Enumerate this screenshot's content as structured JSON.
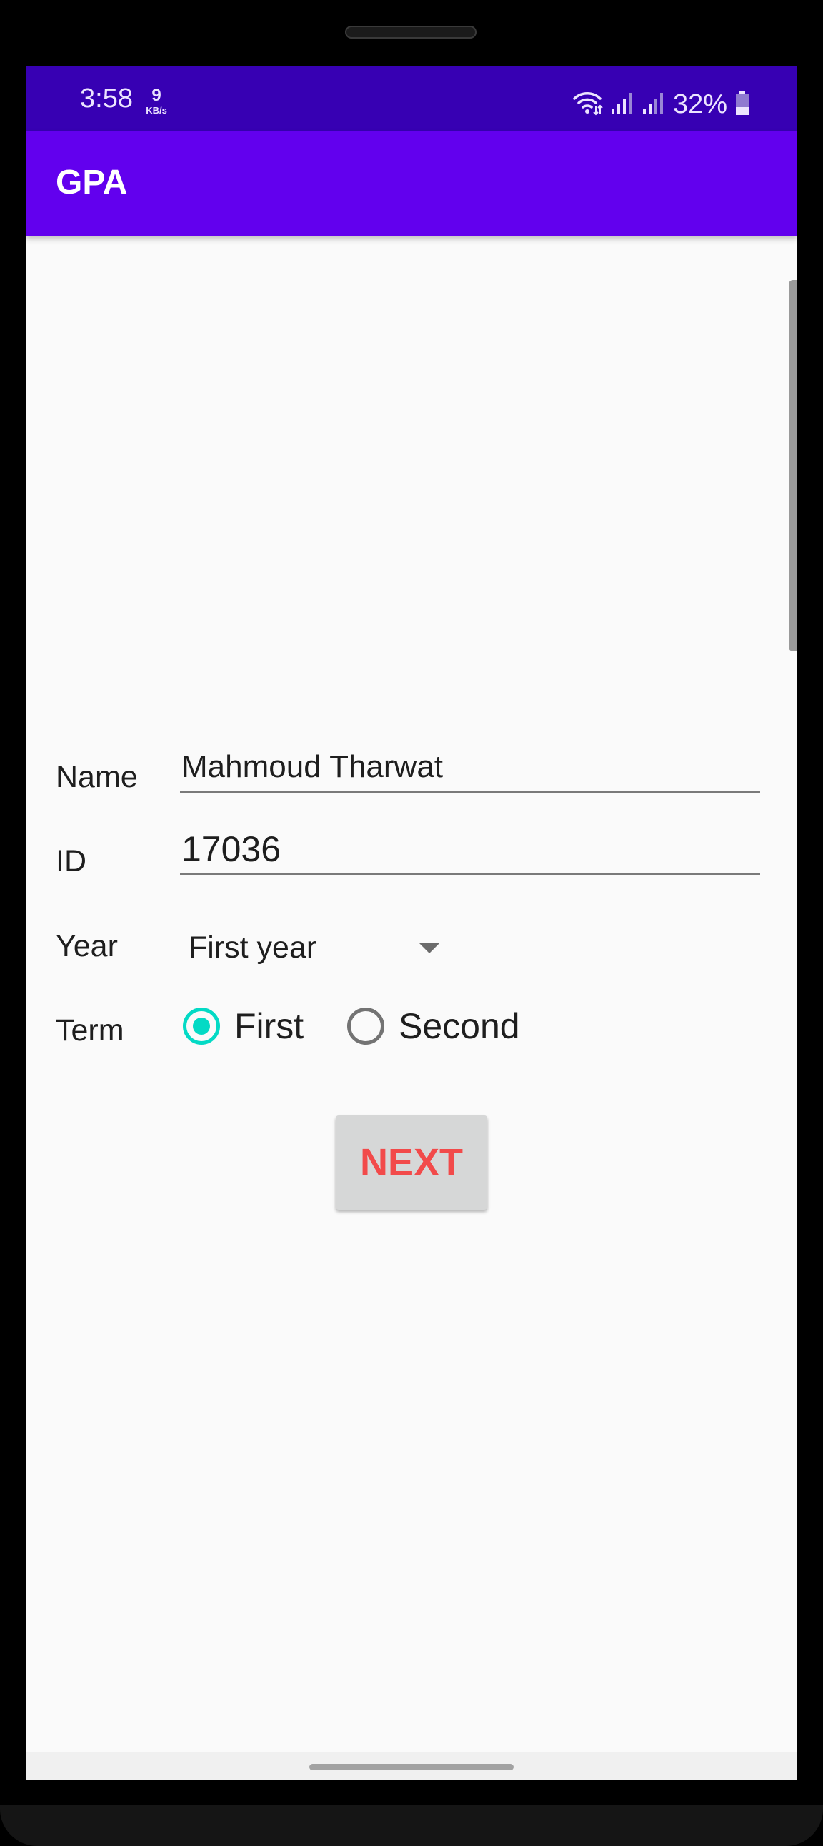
{
  "status_bar": {
    "time": "3:58",
    "net_speed_value": "9",
    "net_speed_unit": "KB/s",
    "battery_percent": "32%",
    "icons": [
      "wifi-icon",
      "signal-icon",
      "signal-icon",
      "battery-icon"
    ]
  },
  "app_bar": {
    "title": "GPA"
  },
  "form": {
    "name_label": "Name",
    "name_value": "Mahmoud Tharwat",
    "id_label": "ID",
    "id_value": "17036",
    "year_label": "Year",
    "year_selected": "First year",
    "term_label": "Term",
    "term_options": [
      {
        "label": "First",
        "checked": true
      },
      {
        "label": "Second",
        "checked": false
      }
    ],
    "next_label": "NEXT"
  },
  "colors": {
    "status_bar": "#3700b3",
    "app_bar": "#6200ee",
    "radio_accent": "#03dac5",
    "next_text": "#f24a4a",
    "next_bg": "#d6d7d7"
  }
}
